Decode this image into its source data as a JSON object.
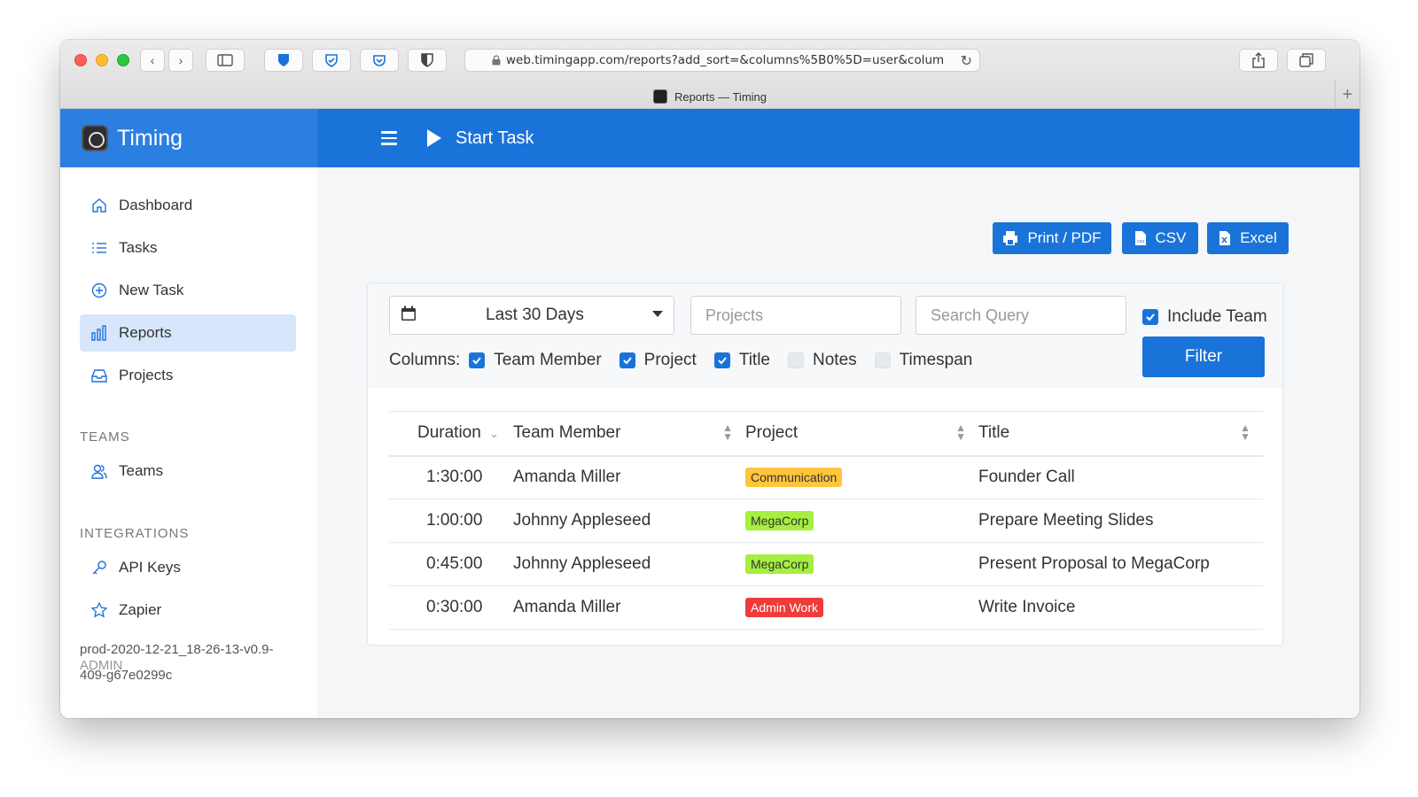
{
  "browser": {
    "url": "web.timingapp.com/reports?add_sort=&columns%5B0%5D=user&colum",
    "tab_title": "Reports — Timing"
  },
  "brand": {
    "name": "Timing"
  },
  "topbar": {
    "start_task": "Start Task"
  },
  "sidebar": {
    "items": [
      {
        "label": "Dashboard",
        "icon": "home-icon"
      },
      {
        "label": "Tasks",
        "icon": "list-icon"
      },
      {
        "label": "New Task",
        "icon": "plus-circle-icon"
      },
      {
        "label": "Reports",
        "icon": "bar-chart-icon",
        "active": true
      },
      {
        "label": "Projects",
        "icon": "inbox-icon"
      }
    ],
    "teams_label": "TEAMS",
    "teams_item": "Teams",
    "integrations_label": "INTEGRATIONS",
    "api_keys": "API Keys",
    "zapier": "Zapier",
    "version_line1": "prod-2020-12-21_18-26-13-v0.9-",
    "version_line2": "409-g67e0299c",
    "admin_overlap": "ADMIN"
  },
  "actions": {
    "print": "Print / PDF",
    "csv": "CSV",
    "excel": "Excel"
  },
  "filters": {
    "date_range": "Last 30 Days",
    "projects_placeholder": "Projects",
    "search_placeholder": "Search Query",
    "include_team": "Include Team",
    "filter_button": "Filter",
    "columns_label": "Columns:",
    "columns": [
      {
        "label": "Team Member",
        "checked": true
      },
      {
        "label": "Project",
        "checked": true
      },
      {
        "label": "Title",
        "checked": true
      },
      {
        "label": "Notes",
        "checked": false
      },
      {
        "label": "Timespan",
        "checked": false
      }
    ]
  },
  "table": {
    "headers": {
      "duration": "Duration",
      "member": "Team Member",
      "project": "Project",
      "title": "Title"
    },
    "rows": [
      {
        "duration": "1:30:00",
        "member": "Amanda Miller",
        "project": "Communication",
        "project_color": "#ffc53d",
        "project_text": "#333333",
        "title": "Founder Call"
      },
      {
        "duration": "1:00:00",
        "member": "Johnny Appleseed",
        "project": "MegaCorp",
        "project_color": "#a6ee3f",
        "project_text": "#333333",
        "title": "Prepare Meeting Slides"
      },
      {
        "duration": "0:45:00",
        "member": "Johnny Appleseed",
        "project": "MegaCorp",
        "project_color": "#a6ee3f",
        "project_text": "#333333",
        "title": "Present Proposal to MegaCorp"
      },
      {
        "duration": "0:30:00",
        "member": "Amanda Miller",
        "project": "Admin Work",
        "project_color": "#f03b3b",
        "project_text": "#ffffff",
        "title": "Write Invoice"
      }
    ]
  },
  "colors": {
    "primary": "#1a73d9",
    "brand_bg": "#2b7fe0",
    "active_nav": "#d7e6fb"
  }
}
